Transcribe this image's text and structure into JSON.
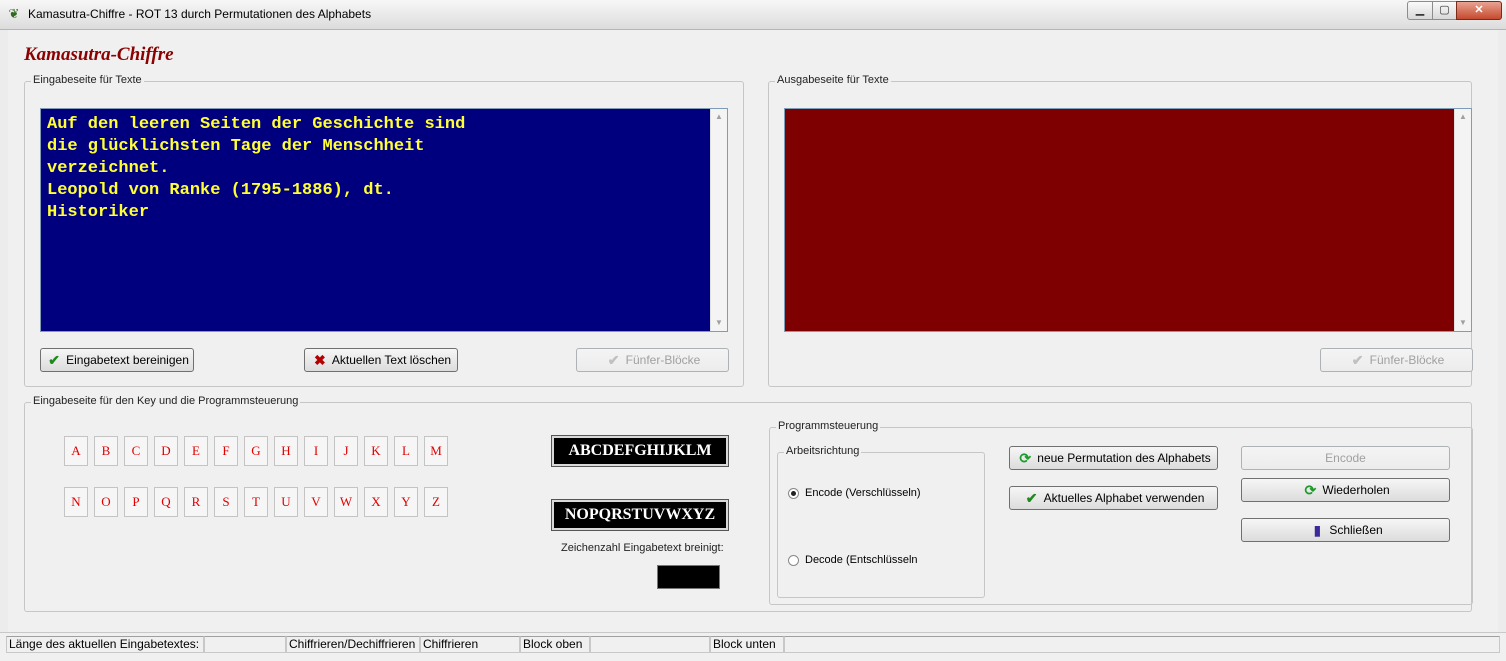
{
  "window": {
    "title": "Kamasutra-Chiffre - ROT 13 durch Permutationen des Alphabets",
    "app_icon": "app-icon"
  },
  "app_title": "Kamasutra-Chiffre",
  "input_section": {
    "label": "Eingabeseite für Texte",
    "text": "Auf den leeren Seiten der Geschichte sind\ndie glücklichsten Tage der Menschheit\nverzeichnet.\nLeopold von Ranke (1795-1886), dt.\nHistoriker",
    "text_color": "#ffff33",
    "background_color": "#00007f",
    "buttons": {
      "clean": "Eingabetext bereinigen",
      "delete": "Aktuellen Text löschen",
      "five_blocks": "Fünfer-Blöcke"
    }
  },
  "output_section": {
    "label": "Ausgabeseite für Texte",
    "text": "",
    "background_color": "#7f0000",
    "buttons": {
      "five_blocks": "Fünfer-Blöcke"
    }
  },
  "key_section": {
    "label": "Eingabeseite für den Key und die Programmsteuerung",
    "letters_row1": [
      "A",
      "B",
      "C",
      "D",
      "E",
      "F",
      "G",
      "H",
      "I",
      "J",
      "K",
      "L",
      "M"
    ],
    "letters_row2": [
      "N",
      "O",
      "P",
      "Q",
      "R",
      "S",
      "T",
      "U",
      "V",
      "W",
      "X",
      "Y",
      "Z"
    ],
    "letter_color": "#e00000",
    "alphabet_top": "ABCDEFGHIJKLM",
    "alphabet_bottom": "NOPQRSTUVWXYZ",
    "count_label": "Zeichenzahl Eingabetext breinigt:",
    "count_value": ""
  },
  "control": {
    "label": "Programmsteuerung",
    "direction": {
      "label": "Arbeitsrichtung",
      "encode": "Encode (Verschlüsseln)",
      "decode": "Decode (Entschlüsseln",
      "selected": "encode"
    },
    "buttons": {
      "new_permutation": "neue Permutation des Alphabets",
      "use_alphabet": "Aktuelles Alphabet verwenden",
      "encode": "Encode",
      "repeat": "Wiederholen",
      "close": "Schließen"
    }
  },
  "statusbar": {
    "length_label": "Länge des aktuellen Eingabetextes:",
    "length_value": "",
    "mode_label": "Chiffrieren/Dechiffrieren",
    "mode_value": "Chiffrieren",
    "block_top": "Block oben",
    "block_top_value": "",
    "block_bottom": "Block unten",
    "block_bottom_value": ""
  }
}
